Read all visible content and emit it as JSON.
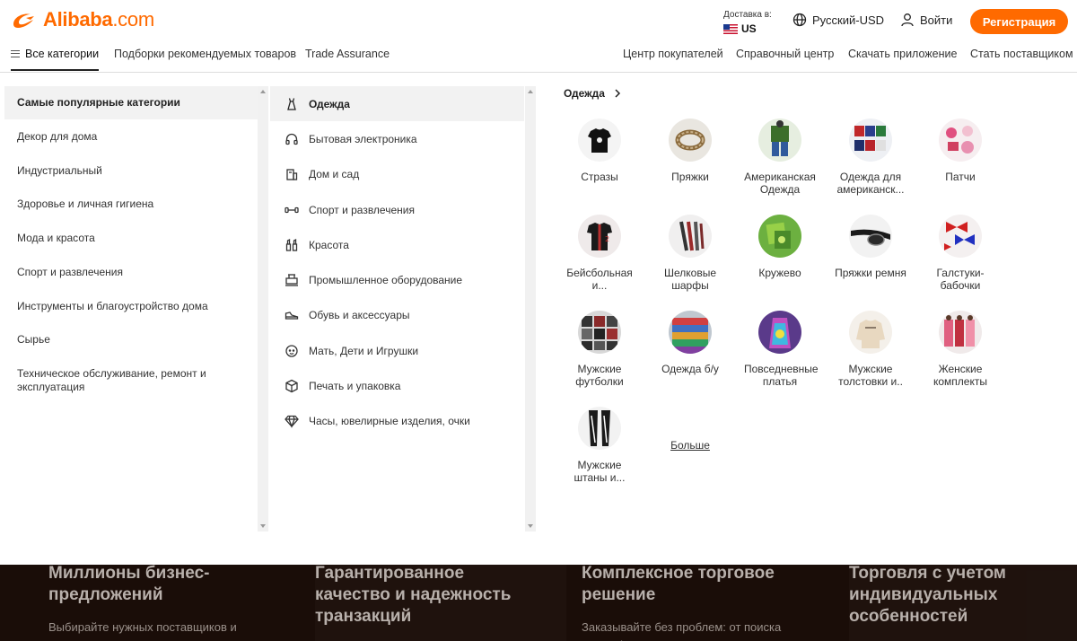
{
  "header": {
    "logo_text": "Alibaba",
    "logo_suffix": ".com",
    "ship_label": "Доставка в:",
    "ship_country": "US",
    "language": "Русский-USD",
    "login": "Войти",
    "register": "Регистрация",
    "brand_color": "#ff6a00"
  },
  "nav": {
    "left": [
      "Все категории",
      "Подборки рекомендуемых товаров",
      "Trade Assurance"
    ],
    "right": [
      "Центр покупателей",
      "Справочный центр",
      "Скачать приложение",
      "Стать поставщиком"
    ]
  },
  "categories": [
    "Самые популярные категории",
    "Декор для дома",
    "Индустриальный",
    "Здоровье и личная гигиена",
    "Мода и красота",
    "Спорт и развлечения",
    "Инструменты и благоустройство дома",
    "Сырье",
    "Техническое обслуживание, ремонт и эксплуатация"
  ],
  "subcategories": [
    {
      "label": "Одежда",
      "icon": "dress-icon"
    },
    {
      "label": "Бытовая электроника",
      "icon": "headphones-icon"
    },
    {
      "label": "Дом и сад",
      "icon": "home-garden-icon"
    },
    {
      "label": "Спорт и развлечения",
      "icon": "dumbbell-icon"
    },
    {
      "label": "Красота",
      "icon": "cosmetics-icon"
    },
    {
      "label": "Промышленное оборудование",
      "icon": "machinery-icon"
    },
    {
      "label": "Обувь и аксессуары",
      "icon": "shoe-icon"
    },
    {
      "label": "Мать, Дети и Игрушки",
      "icon": "baby-icon"
    },
    {
      "label": "Печать и упаковка",
      "icon": "box-icon"
    },
    {
      "label": "Часы, ювелирные изделия, очки",
      "icon": "diamond-icon"
    }
  ],
  "panel": {
    "title": "Одежда",
    "items": [
      {
        "label": "Стразы"
      },
      {
        "label": "Пряжки"
      },
      {
        "label": "Американская Одежда"
      },
      {
        "label": "Одежда для американск..."
      },
      {
        "label": "Патчи"
      },
      {
        "label": "Бейсбольная и..."
      },
      {
        "label": "Шелковые шарфы"
      },
      {
        "label": "Кружево"
      },
      {
        "label": "Пряжки ремня"
      },
      {
        "label": "Галстуки-бабочки"
      },
      {
        "label": "Мужские футболки"
      },
      {
        "label": "Одежда б/у"
      },
      {
        "label": "Повседневные платья"
      },
      {
        "label": "Мужские толстовки и.."
      },
      {
        "label": "Женские комплекты"
      },
      {
        "label": "Мужские штаны и..."
      }
    ],
    "more": "Больше"
  },
  "features": [
    {
      "title": "Миллионы бизнес-предложений",
      "text": "Выбирайте нужных поставщиков и товары для"
    },
    {
      "title": "Гарантированное качество и надежность транзакций",
      "text": ""
    },
    {
      "title": "Комплексное торговое решение",
      "text": "Заказывайте без проблем: от поиска товара/поставщика до"
    },
    {
      "title": "Торговля с учетом индивидуальных особенностей",
      "text": ""
    }
  ]
}
